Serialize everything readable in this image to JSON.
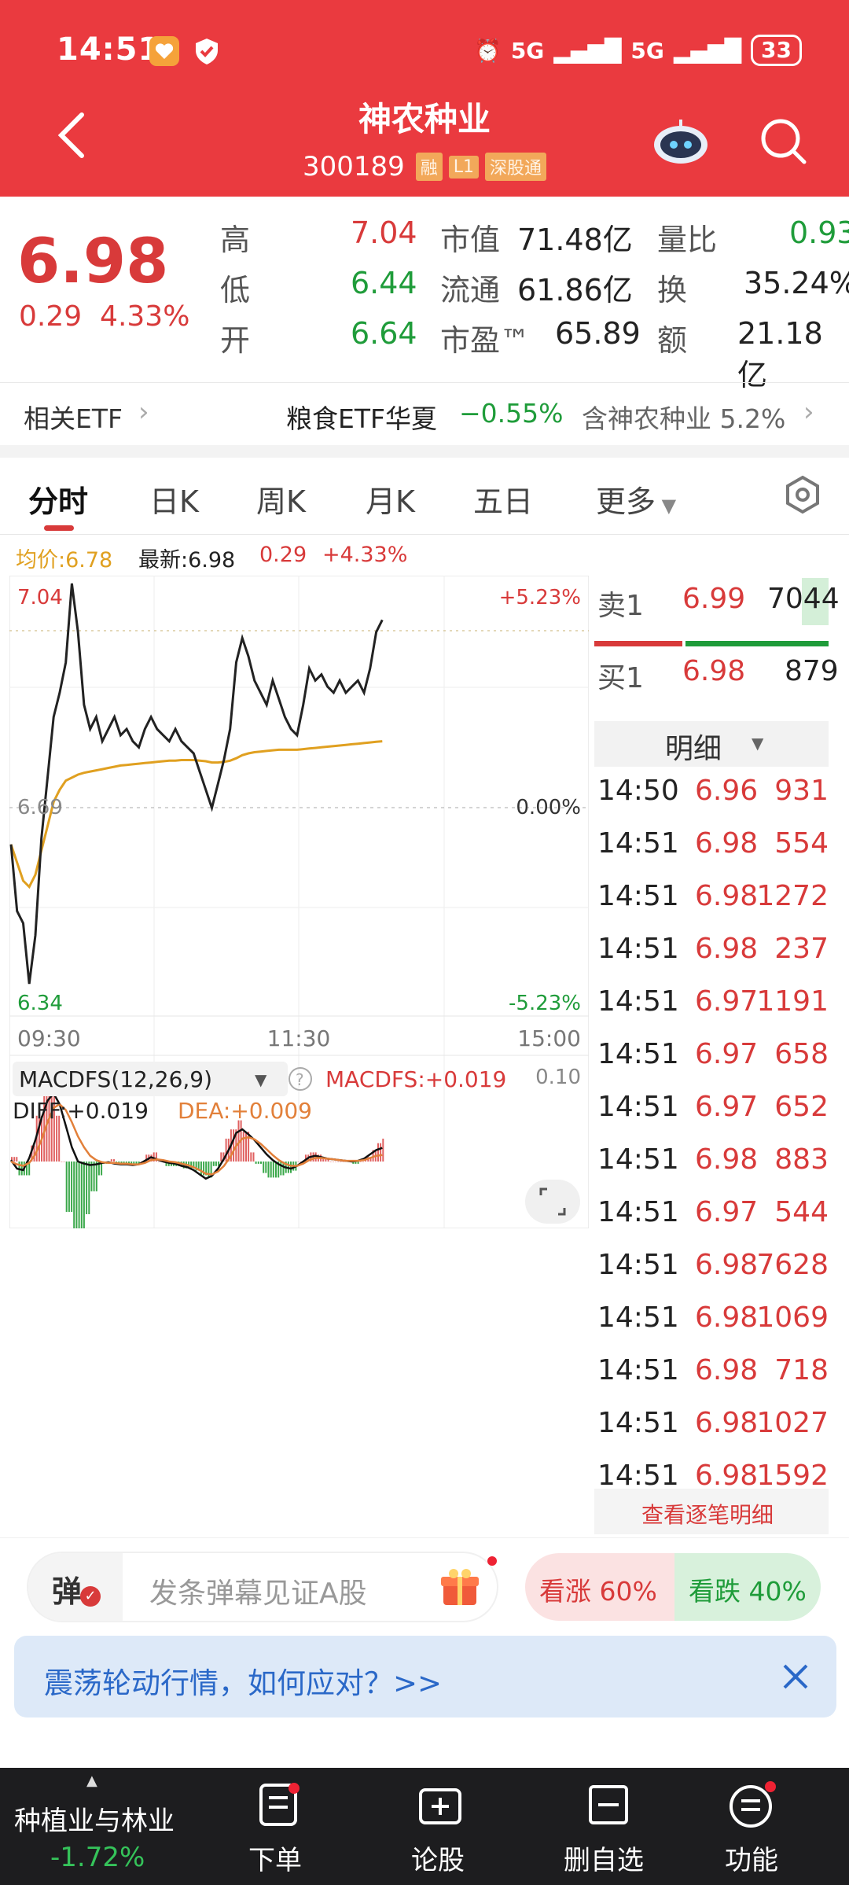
{
  "status_bar": {
    "time": "14:51",
    "network_1": "5G",
    "network_2": "5G",
    "battery": "33"
  },
  "header": {
    "title": "神农种业",
    "code": "300189",
    "tags": [
      "融",
      "L1",
      "深股通"
    ]
  },
  "quote": {
    "price": "6.98",
    "change": "0.29",
    "change_pct": "4.33%",
    "col1": [
      {
        "label": "高",
        "value": "7.04"
      },
      {
        "label": "低",
        "value": "6.44"
      },
      {
        "label": "开",
        "value": "6.64"
      }
    ],
    "col2": [
      {
        "label": "市值",
        "value": "71.48亿"
      },
      {
        "label": "流通",
        "value": "61.86亿"
      },
      {
        "label": "市盈™",
        "value": "65.89"
      }
    ],
    "col3": [
      {
        "label": "量比",
        "value": "0.93"
      },
      {
        "label": "换",
        "value": "35.24%"
      },
      {
        "label": "额",
        "value": "21.18亿"
      }
    ]
  },
  "etf": {
    "label": "相关ETF",
    "name": "粮食ETF华夏",
    "pct": "−0.55%",
    "holding": "含神农种业 5.2%"
  },
  "tabs": [
    "分时",
    "日K",
    "周K",
    "月K",
    "五日",
    "更多"
  ],
  "info_line": {
    "avg": "均价:6.78",
    "latest": "最新:6.98",
    "change": "0.29",
    "change_pct": "+4.33%"
  },
  "chart_labels": {
    "top_price": "7.04",
    "top_pct": "+5.23%",
    "mid_price": "6.69",
    "mid_pct": "0.00%",
    "bottom_price": "6.34",
    "bottom_pct": "-5.23%",
    "time_start": "09:30",
    "time_mid": "11:30",
    "time_end": "15:00"
  },
  "chart_data": {
    "type": "line",
    "title": "",
    "x_range": [
      "09:30",
      "15:00"
    ],
    "ylim": [
      6.34,
      7.04
    ],
    "reference": 6.69,
    "series": [
      {
        "name": "最新",
        "color": "#222222",
        "values": [
          6.61,
          6.5,
          6.48,
          6.38,
          6.46,
          6.62,
          6.72,
          6.82,
          6.86,
          6.91,
          7.04,
          6.96,
          6.84,
          6.8,
          6.82,
          6.78,
          6.8,
          6.82,
          6.79,
          6.8,
          6.78,
          6.77,
          6.8,
          6.82,
          6.8,
          6.79,
          6.78,
          6.8,
          6.78,
          6.77,
          6.76,
          6.73,
          6.7,
          6.67,
          6.71,
          6.75,
          6.8,
          6.91,
          6.95,
          6.92,
          6.88,
          6.86,
          6.84,
          6.88,
          6.85,
          6.82,
          6.8,
          6.79,
          6.84,
          6.9,
          6.88,
          6.89,
          6.87,
          6.86,
          6.88,
          6.86,
          6.87,
          6.88,
          6.86,
          6.9,
          6.96,
          6.98
        ]
      },
      {
        "name": "均价",
        "color": "#e0a020",
        "values": [
          6.61,
          6.58,
          6.55,
          6.54,
          6.56,
          6.6,
          6.64,
          6.68,
          6.7,
          6.715,
          6.72,
          6.725,
          6.728,
          6.73,
          6.732,
          6.734,
          6.736,
          6.738,
          6.74,
          6.741,
          6.742,
          6.743,
          6.744,
          6.745,
          6.746,
          6.747,
          6.748,
          6.748,
          6.749,
          6.749,
          6.749,
          6.748,
          6.747,
          6.745,
          6.745,
          6.746,
          6.748,
          6.752,
          6.757,
          6.76,
          6.762,
          6.763,
          6.764,
          6.765,
          6.766,
          6.766,
          6.766,
          6.766,
          6.767,
          6.768,
          6.769,
          6.77,
          6.771,
          6.772,
          6.773,
          6.774,
          6.775,
          6.776,
          6.777,
          6.778,
          6.779,
          6.78
        ]
      }
    ],
    "macd": {
      "label": "MACDFS(12,26,9)",
      "macdfs": "MACDFS:+0.019",
      "diff": "DIFF:+0.019",
      "dea": "DEA:+0.009",
      "max": "0.10"
    }
  },
  "order_book": {
    "sell": {
      "label": "卖1",
      "price": "6.99",
      "volume": "7044"
    },
    "buy": {
      "label": "买1",
      "price": "6.98",
      "volume": "879"
    },
    "detail_label": "明细"
  },
  "trades": [
    {
      "time": "14:50",
      "price": "6.96",
      "volume": "931"
    },
    {
      "time": "14:51",
      "price": "6.98",
      "volume": "554"
    },
    {
      "time": "14:51",
      "price": "6.98",
      "volume": "1272"
    },
    {
      "time": "14:51",
      "price": "6.98",
      "volume": "237"
    },
    {
      "time": "14:51",
      "price": "6.97",
      "volume": "1191"
    },
    {
      "time": "14:51",
      "price": "6.97",
      "volume": "658"
    },
    {
      "time": "14:51",
      "price": "6.97",
      "volume": "652"
    },
    {
      "time": "14:51",
      "price": "6.98",
      "volume": "883"
    },
    {
      "time": "14:51",
      "price": "6.97",
      "volume": "544"
    },
    {
      "time": "14:51",
      "price": "6.98",
      "volume": "7628"
    },
    {
      "time": "14:51",
      "price": "6.98",
      "volume": "1069"
    },
    {
      "time": "14:51",
      "price": "6.98",
      "volume": "718"
    },
    {
      "time": "14:51",
      "price": "6.98",
      "volume": "1027"
    },
    {
      "time": "14:51",
      "price": "6.98",
      "volume": "1592"
    }
  ],
  "view_details": "查看逐笔明细",
  "danmu": {
    "icon_label": "弹",
    "placeholder": "发条弹幕见证A股",
    "up": "看涨 60%",
    "down": "看跌 40%"
  },
  "banner": {
    "text": "震荡轮动行情，如何应对？>>"
  },
  "bottom_nav": {
    "sector": "种植业与林业",
    "sector_pct": "-1.72%",
    "items": [
      "下单",
      "论股",
      "删自选",
      "功能"
    ]
  },
  "colors": {
    "brand_red": "#ea3a3f",
    "up_red": "#d83a3a",
    "down_green": "#1f9c3a",
    "avg_line": "#e0a020"
  }
}
